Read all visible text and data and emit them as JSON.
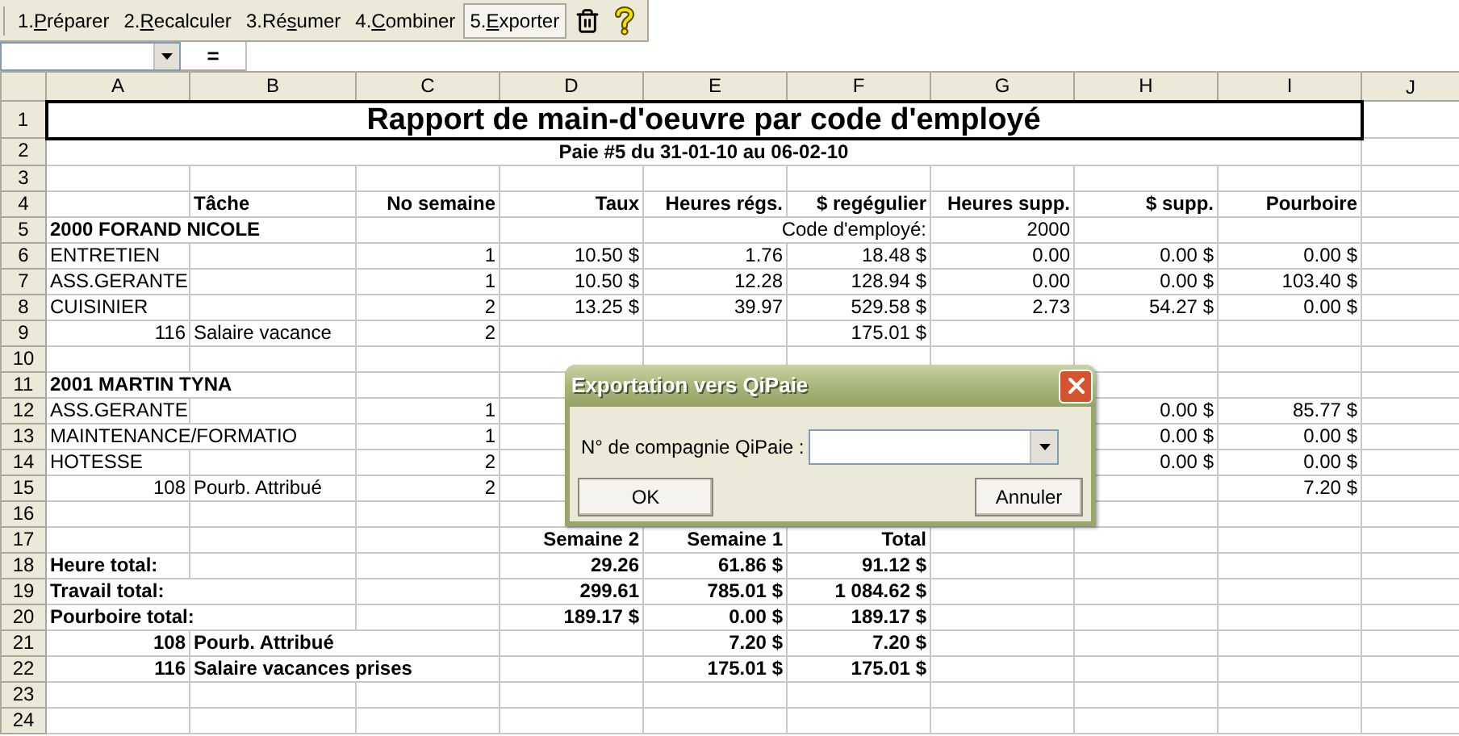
{
  "toolbar": {
    "buttons": [
      {
        "label_parts": [
          "1.",
          "P",
          "réparer"
        ],
        "selected": false
      },
      {
        "label_parts": [
          "2.",
          "R",
          "ecalculer"
        ],
        "selected": false
      },
      {
        "label_parts": [
          "3.Ré",
          "s",
          "umer"
        ],
        "selected": false
      },
      {
        "label_parts": [
          "4.",
          "C",
          "ombiner"
        ],
        "selected": false
      },
      {
        "label_parts": [
          "5.",
          "E",
          "xporter"
        ],
        "selected": true
      }
    ]
  },
  "formula_bar": {
    "equals": "="
  },
  "columns": [
    "A",
    "B",
    "C",
    "D",
    "E",
    "F",
    "G",
    "H",
    "I",
    "J"
  ],
  "rows": [
    {
      "number": "1",
      "kind": "title",
      "cells": [
        {
          "text": "Rapport de main-d'oeuvre par code d'employé"
        }
      ]
    },
    {
      "number": "2",
      "kind": "subtitle",
      "cells": [
        {
          "text": "Paie #5 du 31-01-10 au 06-02-10"
        }
      ]
    },
    {
      "number": "3",
      "kind": "grid",
      "cells": []
    },
    {
      "number": "4",
      "kind": "grid",
      "cells": [
        null,
        {
          "text": "Tâche",
          "kind": "strong_label"
        },
        {
          "text": "No semaine",
          "kind": "strong_value"
        },
        {
          "text": "Taux",
          "kind": "strong_value"
        },
        {
          "text": "Heures régs.",
          "kind": "strong_value"
        },
        {
          "text": "$ regégulier",
          "kind": "strong_value"
        },
        {
          "text": "Heures supp.",
          "kind": "strong_value"
        },
        {
          "text": "$ supp.",
          "kind": "strong_value"
        },
        {
          "text": "Pourboire",
          "kind": "strong_value"
        }
      ]
    },
    {
      "number": "5",
      "kind": "grid",
      "cells": [
        {
          "text": "2000 FORAND NICOLE",
          "kind": "strong_label"
        },
        null,
        null,
        null,
        null,
        {
          "text": "Code d'employé:",
          "kind": "value"
        },
        {
          "text": "2000",
          "kind": "value"
        }
      ]
    },
    {
      "number": "6",
      "kind": "grid",
      "cells": [
        {
          "text": "ENTRETIEN",
          "kind": "label"
        },
        null,
        {
          "text": "1",
          "kind": "value"
        },
        {
          "text": "10.50 $",
          "kind": "value"
        },
        {
          "text": "1.76",
          "kind": "value"
        },
        {
          "text": "18.48 $",
          "kind": "value"
        },
        {
          "text": "0.00",
          "kind": "value"
        },
        {
          "text": "0.00 $",
          "kind": "value"
        },
        {
          "text": "0.00 $",
          "kind": "value"
        }
      ]
    },
    {
      "number": "7",
      "kind": "grid",
      "cells": [
        {
          "text": "ASS.GERANTE",
          "kind": "label"
        },
        null,
        {
          "text": "1",
          "kind": "value"
        },
        {
          "text": "10.50 $",
          "kind": "value"
        },
        {
          "text": "12.28",
          "kind": "value"
        },
        {
          "text": "128.94 $",
          "kind": "value"
        },
        {
          "text": "0.00",
          "kind": "value"
        },
        {
          "text": "0.00 $",
          "kind": "value"
        },
        {
          "text": "103.40 $",
          "kind": "value"
        }
      ]
    },
    {
      "number": "8",
      "kind": "grid",
      "cells": [
        {
          "text": "CUISINIER",
          "kind": "label"
        },
        null,
        {
          "text": "2",
          "kind": "value"
        },
        {
          "text": "13.25 $",
          "kind": "value"
        },
        {
          "text": "39.97",
          "kind": "value"
        },
        {
          "text": "529.58 $",
          "kind": "value"
        },
        {
          "text": "2.73",
          "kind": "value"
        },
        {
          "text": "54.27 $",
          "kind": "value"
        },
        {
          "text": "0.00 $",
          "kind": "value"
        }
      ]
    },
    {
      "number": "9",
      "kind": "grid",
      "cells": [
        {
          "text": "116",
          "kind": "value"
        },
        {
          "text": "Salaire vacance",
          "kind": "label"
        },
        {
          "text": "2",
          "kind": "value"
        },
        null,
        null,
        {
          "text": "175.01 $",
          "kind": "value"
        }
      ]
    },
    {
      "number": "10",
      "kind": "grid",
      "cells": []
    },
    {
      "number": "11",
      "kind": "grid",
      "cells": [
        {
          "text": "2001 MARTIN TYNA",
          "kind": "strong_label"
        }
      ]
    },
    {
      "number": "12",
      "kind": "grid",
      "cells": [
        {
          "text": "ASS.GERANTE",
          "kind": "label"
        },
        null,
        {
          "text": "1",
          "kind": "value"
        },
        null,
        null,
        null,
        null,
        {
          "text": "0.00 $",
          "kind": "value"
        },
        {
          "text": "85.77 $",
          "kind": "value"
        }
      ]
    },
    {
      "number": "13",
      "kind": "grid",
      "cells": [
        {
          "text": "MAINTENANCE/FORMATIO",
          "kind": "label"
        },
        null,
        {
          "text": "1",
          "kind": "value"
        },
        null,
        null,
        null,
        null,
        {
          "text": "0.00 $",
          "kind": "value"
        },
        {
          "text": "0.00 $",
          "kind": "value"
        }
      ]
    },
    {
      "number": "14",
      "kind": "grid",
      "cells": [
        {
          "text": "HOTESSE",
          "kind": "label"
        },
        null,
        {
          "text": "2",
          "kind": "value"
        },
        null,
        null,
        null,
        null,
        {
          "text": "0.00 $",
          "kind": "value"
        },
        {
          "text": "0.00 $",
          "kind": "value"
        }
      ]
    },
    {
      "number": "15",
      "kind": "grid",
      "cells": [
        {
          "text": "108",
          "kind": "value"
        },
        {
          "text": "Pourb. Attribué",
          "kind": "label"
        },
        {
          "text": "2",
          "kind": "value"
        },
        null,
        null,
        null,
        null,
        null,
        {
          "text": "7.20 $",
          "kind": "value"
        }
      ]
    },
    {
      "number": "16",
      "kind": "grid",
      "cells": []
    },
    {
      "number": "17",
      "kind": "grid",
      "cells": [
        null,
        null,
        null,
        {
          "text": "Semaine 2",
          "kind": "strong_value"
        },
        {
          "text": "Semaine 1",
          "kind": "strong_value"
        },
        {
          "text": "Total",
          "kind": "strong_value"
        }
      ]
    },
    {
      "number": "18",
      "kind": "grid",
      "cells": [
        {
          "text": "Heure total:",
          "kind": "strong_label"
        },
        null,
        null,
        {
          "text": "29.26",
          "kind": "strong_value"
        },
        {
          "text": "61.86 $",
          "kind": "strong_value"
        },
        {
          "text": "91.12 $",
          "kind": "strong_value"
        }
      ]
    },
    {
      "number": "19",
      "kind": "grid",
      "cells": [
        {
          "text": "Travail total:",
          "kind": "strong_label"
        },
        null,
        null,
        {
          "text": "299.61",
          "kind": "strong_value"
        },
        {
          "text": "785.01 $",
          "kind": "strong_value"
        },
        {
          "text": "1 084.62 $",
          "kind": "strong_value"
        }
      ]
    },
    {
      "number": "20",
      "kind": "grid",
      "cells": [
        {
          "text": "Pourboire total:",
          "kind": "strong_label"
        },
        null,
        null,
        {
          "text": "189.17 $",
          "kind": "strong_value"
        },
        {
          "text": "0.00 $",
          "kind": "strong_value"
        },
        {
          "text": "189.17 $",
          "kind": "strong_value"
        }
      ]
    },
    {
      "number": "21",
      "kind": "grid",
      "cells": [
        {
          "text": "108",
          "kind": "strong_value"
        },
        {
          "text": "Pourb. Attribué",
          "kind": "strong_label"
        },
        null,
        null,
        {
          "text": "7.20 $",
          "kind": "strong_value"
        },
        {
          "text": "7.20 $",
          "kind": "strong_value"
        }
      ]
    },
    {
      "number": "22",
      "kind": "grid",
      "cells": [
        {
          "text": "116",
          "kind": "strong_value"
        },
        {
          "text": "Salaire vacances prises",
          "kind": "strong_label"
        },
        null,
        null,
        {
          "text": "175.01 $",
          "kind": "strong_value"
        },
        {
          "text": "175.01 $",
          "kind": "strong_value"
        }
      ]
    },
    {
      "number": "23",
      "kind": "grid",
      "cells": []
    },
    {
      "number": "24",
      "kind": "grid",
      "cells": []
    }
  ],
  "dialog": {
    "title": "Exportation vers QiPaie",
    "field_label": "N° de compagnie QiPaie :",
    "buttons": [
      "OK",
      "Annuler"
    ]
  }
}
